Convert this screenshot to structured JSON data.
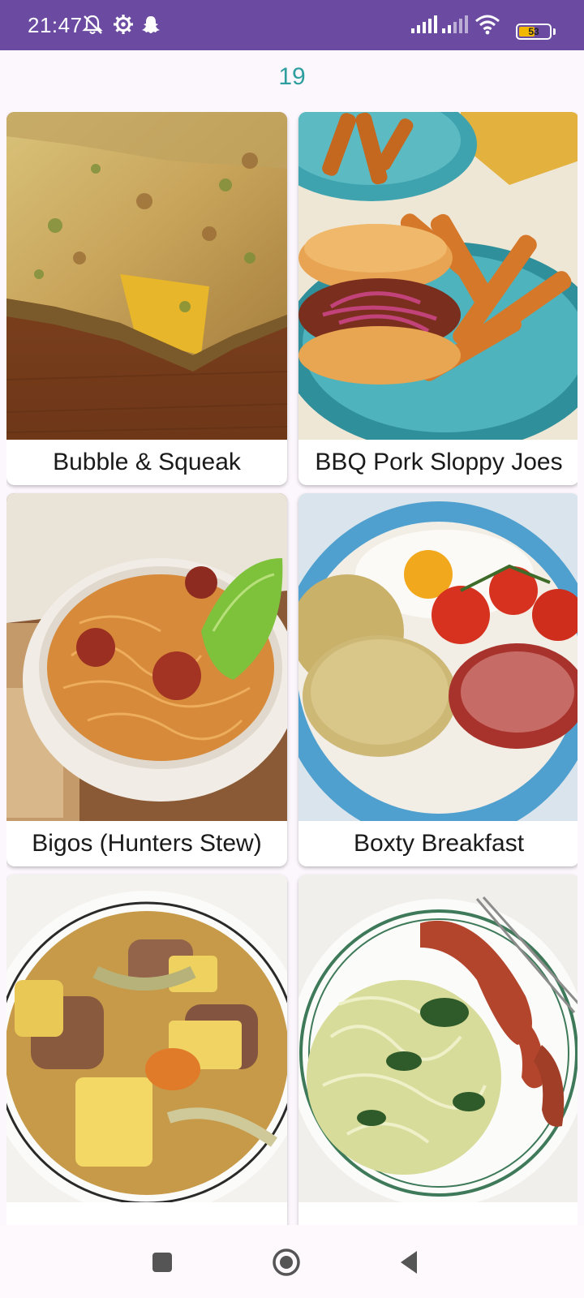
{
  "status_bar": {
    "time": "21:47",
    "battery_level": "53",
    "battery_fraction": 0.53,
    "icons_left": [
      "muted-bell-icon",
      "settings-gear-icon",
      "snapchat-ghost-icon"
    ],
    "icons_right": [
      "signal-bars-icon",
      "signal-bars-secondary-icon",
      "wifi-icon",
      "battery-icon"
    ],
    "bar_color": "#6a4ba1",
    "battery_color": "#f2b800"
  },
  "page_counter": "19",
  "meals": [
    {
      "title": "Bubble & Squeak",
      "image": "bubble-and-squeak-photo"
    },
    {
      "title": "BBQ Pork Sloppy Joes",
      "image": "bbq-pork-sloppy-joes-photo"
    },
    {
      "title": "Bigos (Hunters Stew)",
      "image": "bigos-hunters-stew-photo"
    },
    {
      "title": "Boxty Breakfast",
      "image": "boxty-breakfast-photo"
    },
    {
      "title": "",
      "image": "pork-stew-photo"
    },
    {
      "title": "",
      "image": "sausage-and-cabbage-photo"
    }
  ],
  "nav_bar": {
    "buttons": [
      "recents-square-icon",
      "home-circle-icon",
      "back-triangle-icon"
    ]
  },
  "colors": {
    "accent_teal": "#2f9e9e",
    "background": "#fcf7fd"
  }
}
